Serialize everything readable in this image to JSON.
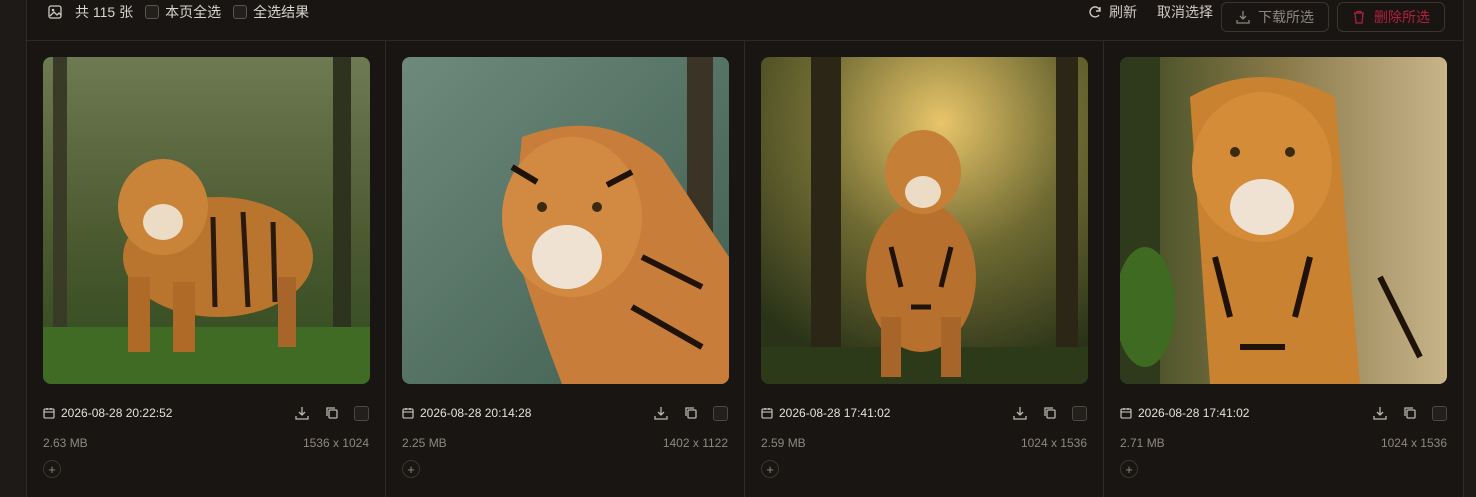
{
  "toolbar": {
    "total_label": "共 115 张",
    "select_page_label": "本页全选",
    "select_all_label": "全选结果",
    "refresh_label": "刷新",
    "cancel_select_label": "取消选择",
    "download_selected_label": "下载所选",
    "delete_selected_label": "删除所选"
  },
  "colors": {
    "background": "#181512",
    "danger": "#b0203d",
    "muted_text": "#8e8881"
  },
  "images": [
    {
      "date": "2026-08-28 20:22:52",
      "size": "2.63 MB",
      "dimensions": "1536 x 1024",
      "icon": "date-icon"
    },
    {
      "date": "2026-08-28 20:14:28",
      "size": "2.25 MB",
      "dimensions": "1402 x 1122",
      "icon": "date-icon"
    },
    {
      "date": "2026-08-28 17:41:02",
      "size": "2.59 MB",
      "dimensions": "1024 x 1536",
      "icon": "date-icon"
    },
    {
      "date": "2026-08-28 17:41:02",
      "size": "2.71 MB",
      "dimensions": "1024 x 1536",
      "icon": "date-icon"
    }
  ],
  "add_label": "+"
}
